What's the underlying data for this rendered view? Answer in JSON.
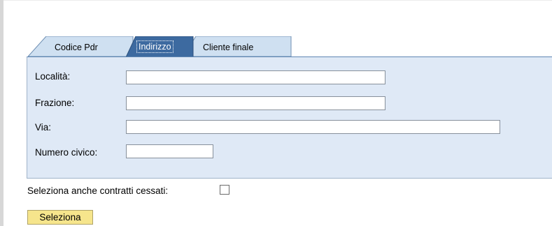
{
  "tabs": [
    {
      "label": "Codice Pdr",
      "selected": false
    },
    {
      "label": "Indirizzo",
      "selected": true
    },
    {
      "label": "Cliente finale",
      "selected": false
    }
  ],
  "form": {
    "localita_label": "Località:",
    "localita_value": "",
    "frazione_label": "Frazione:",
    "frazione_value": "",
    "via_label": "Via:",
    "via_value": "",
    "numero_civico_label": "Numero civico:",
    "numero_civico_value": ""
  },
  "options": {
    "contratti_cessati_label": "Seleziona anche contratti cessati:",
    "contratti_cessati_checked": false
  },
  "actions": {
    "seleziona_label": "Seleziona"
  },
  "colors": {
    "panel_bg": "#dfe9f6",
    "tab_inactive_bg": "#cfe0f1",
    "tab_active_bg": "#3d6aa0",
    "button_bg": "#f6e58c"
  }
}
